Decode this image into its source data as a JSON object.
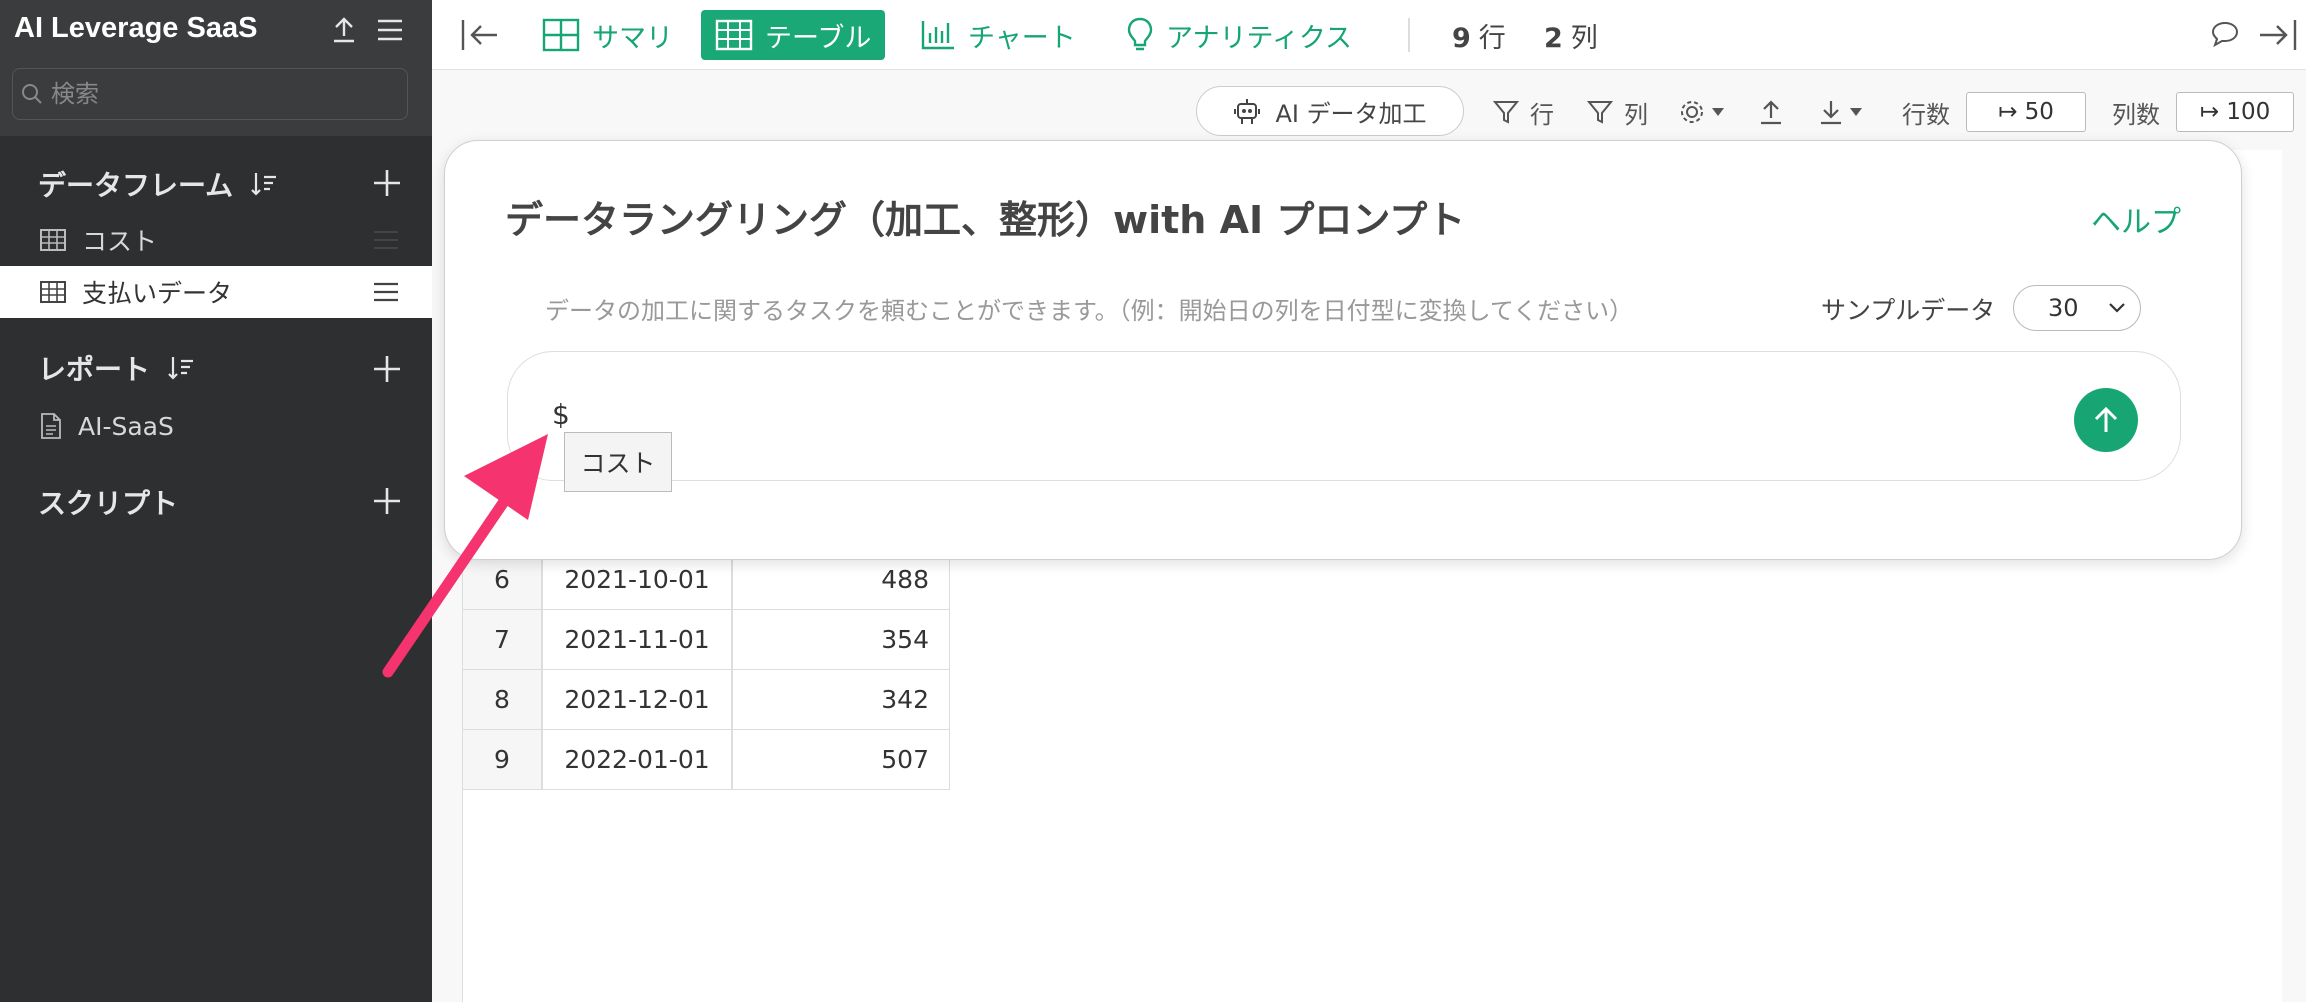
{
  "sidebar": {
    "app_title": "AI Leverage SaaS",
    "search_placeholder": "検索",
    "sections": {
      "dataframes": {
        "label": "データフレーム",
        "items": [
          {
            "label": "コスト"
          },
          {
            "label": "支払いデータ"
          }
        ]
      },
      "reports": {
        "label": "レポート",
        "items": [
          {
            "label": "AI-SaaS"
          }
        ]
      },
      "scripts": {
        "label": "スクリプト"
      }
    }
  },
  "toolbar": {
    "tabs": [
      {
        "label": "サマリ"
      },
      {
        "label": "テーブル"
      },
      {
        "label": "チャート"
      },
      {
        "label": "アナリティクス"
      }
    ],
    "rows_count": "9",
    "rows_unit": "行",
    "cols_count": "2",
    "cols_unit": "列"
  },
  "subbar": {
    "ai_button": "AI データ加工",
    "row_filter": "行",
    "col_filter": "列",
    "rows_label": "行数",
    "rows_value": "↦ 50",
    "cols_label": "列数",
    "cols_value": "↦ 100"
  },
  "table": {
    "rows": [
      {
        "idx": "6",
        "date": "2021-10-01",
        "value": "488"
      },
      {
        "idx": "7",
        "date": "2021-11-01",
        "value": "354"
      },
      {
        "idx": "8",
        "date": "2021-12-01",
        "value": "342"
      },
      {
        "idx": "9",
        "date": "2022-01-01",
        "value": "507"
      }
    ]
  },
  "dialog": {
    "title": "データラングリング（加工、整形）with AI プロンプト",
    "help": "ヘルプ",
    "description": "データの加工に関するタスクを頼むことができます。（例：開始日の列を日付型に変換してください）",
    "sample_label": "サンプルデータ",
    "sample_value": "30",
    "prompt_text": "$",
    "suggestion": "コスト"
  },
  "colors": {
    "accent": "#17a673",
    "annotation_arrow": "#f4336f",
    "sidebar_bg": "#2e2f30"
  }
}
